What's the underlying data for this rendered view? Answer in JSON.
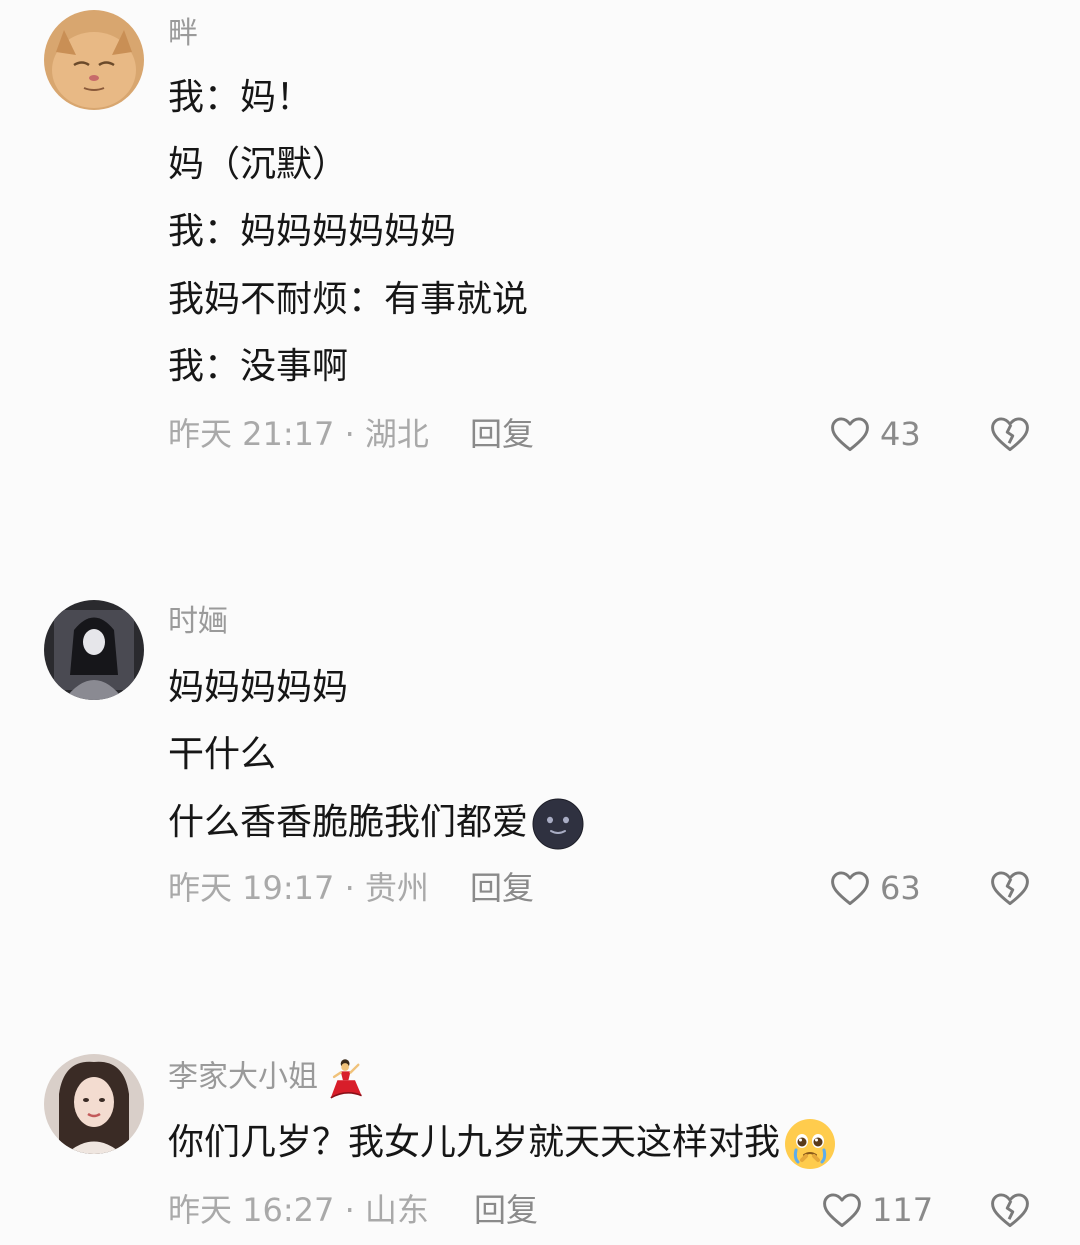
{
  "comments": [
    {
      "username": "畔",
      "lines": [
        "我：妈！",
        "妈（沉默）",
        "我：妈妈妈妈妈妈",
        "我妈不耐烦：有事就说",
        "我：没事啊"
      ],
      "meta": "昨天 21:17 · 湖北",
      "reply": "回复",
      "likes": "43"
    },
    {
      "username": "时婳",
      "lines": [
        "妈妈妈妈妈",
        "干什么",
        "什么香香脆脆我们都爱"
      ],
      "meta": "昨天 19:17 · 贵州",
      "reply": "回复",
      "likes": "63",
      "emoji": "new-moon-face"
    },
    {
      "username": "李家大小姐",
      "lines": [
        "你们几岁？我女儿九岁就天天这样对我"
      ],
      "meta": "昨天 16:27 · 山东",
      "reply": "回复",
      "likes": "117",
      "badge": "flamenco-dancer-emoji",
      "emoji": "pleading-face"
    }
  ],
  "colors": {
    "background": "#fbfbfb",
    "text": "#161616",
    "muted": "#a9a9a9"
  },
  "icons": {
    "like": "heart-outline-icon",
    "dislike": "broken-heart-icon"
  }
}
